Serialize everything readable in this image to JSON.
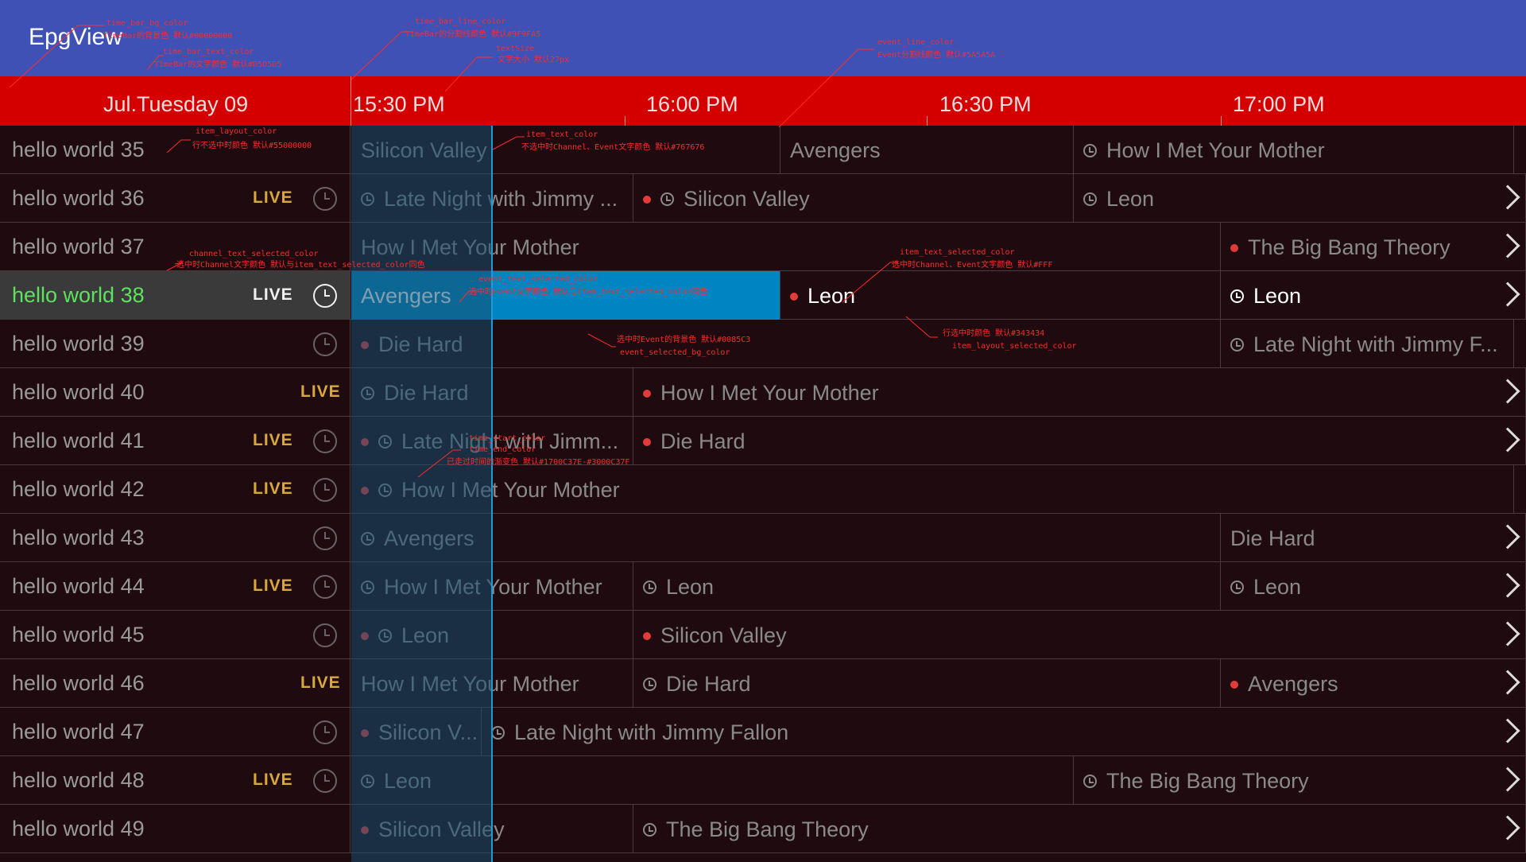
{
  "app": {
    "title": "EpgView"
  },
  "timebar": {
    "date": "Jul.Tuesday 09",
    "ticks": [
      "15:30 PM",
      "16:00 PM",
      "16:30 PM",
      "17:00 PM"
    ]
  },
  "colors": {
    "appbar": "#3f51b5",
    "timebar_bg": "#d40000",
    "grid_bg": "#1e0a0f",
    "selected_event_bg": "#0085c3",
    "selected_row_bg": "#3a3a3a",
    "selected_channel_text": "#5de25d",
    "live_badge": "#d8a93a",
    "now_line": "#1d9bd8",
    "annotation": "#ff2a2a"
  },
  "rows": [
    {
      "channel": "hello world 35",
      "live": false,
      "clock": false,
      "chevron": false,
      "events": [
        {
          "title": "Silicon Valley",
          "dot": false,
          "alarm": false
        },
        {
          "title": "Avengers",
          "dot": false,
          "alarm": false
        },
        {
          "title": "How I Met Your Mother",
          "dot": false,
          "alarm": true
        }
      ]
    },
    {
      "channel": "hello world 36",
      "live": true,
      "clock": true,
      "chevron": true,
      "events": [
        {
          "title": "Late Night with Jimmy ...",
          "dot": false,
          "alarm": true
        },
        {
          "title": "Silicon Valley",
          "dot": true,
          "alarm": true
        },
        {
          "title": "Leon",
          "dot": false,
          "alarm": true
        }
      ]
    },
    {
      "channel": "hello world 37",
      "live": false,
      "clock": false,
      "chevron": true,
      "events": [
        {
          "title": "How I Met Your Mother",
          "dot": false,
          "alarm": false
        },
        {
          "title": "The Big Bang Theory",
          "dot": true,
          "alarm": false
        }
      ]
    },
    {
      "channel": "hello world 38",
      "live": true,
      "clock": true,
      "chevron": true,
      "selected": true,
      "events": [
        {
          "title": "Avengers",
          "dot": false,
          "alarm": false,
          "selected": true
        },
        {
          "title": "Leon",
          "dot": true,
          "alarm": false
        },
        {
          "title": "Leon",
          "dot": false,
          "alarm": true
        }
      ]
    },
    {
      "channel": "hello world 39",
      "live": false,
      "clock": true,
      "chevron": false,
      "events": [
        {
          "title": "Die Hard",
          "dot": true,
          "alarm": false
        },
        {
          "title": "Late Night with Jimmy F...",
          "dot": false,
          "alarm": true
        }
      ]
    },
    {
      "channel": "hello world 40",
      "live": true,
      "clock": false,
      "chevron": true,
      "events": [
        {
          "title": "Die Hard",
          "dot": false,
          "alarm": true
        },
        {
          "title": "How I Met Your Mother",
          "dot": true,
          "alarm": false
        }
      ]
    },
    {
      "channel": "hello world 41",
      "live": true,
      "clock": true,
      "chevron": true,
      "events": [
        {
          "title": "Late Night with Jimm...",
          "dot": true,
          "alarm": true
        },
        {
          "title": "Die Hard",
          "dot": true,
          "alarm": false
        }
      ]
    },
    {
      "channel": "hello world 42",
      "live": true,
      "clock": true,
      "chevron": false,
      "events": [
        {
          "title": "How I Met Your Mother",
          "dot": true,
          "alarm": true
        }
      ]
    },
    {
      "channel": "hello world 43",
      "live": false,
      "clock": true,
      "chevron": true,
      "events": [
        {
          "title": "Avengers",
          "dot": false,
          "alarm": true
        },
        {
          "title": "Die Hard",
          "dot": false,
          "alarm": false
        }
      ]
    },
    {
      "channel": "hello world 44",
      "live": true,
      "clock": true,
      "chevron": true,
      "events": [
        {
          "title": "How I Met Your Mother",
          "dot": false,
          "alarm": true
        },
        {
          "title": "Leon",
          "dot": false,
          "alarm": true
        },
        {
          "title": "Leon",
          "dot": false,
          "alarm": true
        }
      ]
    },
    {
      "channel": "hello world 45",
      "live": false,
      "clock": true,
      "chevron": true,
      "events": [
        {
          "title": "Leon",
          "dot": true,
          "alarm": true
        },
        {
          "title": "Silicon Valley",
          "dot": true,
          "alarm": false
        }
      ]
    },
    {
      "channel": "hello world 46",
      "live": true,
      "clock": false,
      "chevron": true,
      "events": [
        {
          "title": "How I Met Your Mother",
          "dot": false,
          "alarm": false
        },
        {
          "title": "Die Hard",
          "dot": false,
          "alarm": true
        },
        {
          "title": "Avengers",
          "dot": true,
          "alarm": false
        }
      ]
    },
    {
      "channel": "hello world 47",
      "live": false,
      "clock": true,
      "chevron": true,
      "events": [
        {
          "title": "Silicon V...",
          "dot": true,
          "alarm": false
        },
        {
          "title": "Late Night with Jimmy Fallon",
          "dot": false,
          "alarm": true
        }
      ]
    },
    {
      "channel": "hello world 48",
      "live": true,
      "clock": true,
      "chevron": true,
      "events": [
        {
          "title": "Leon",
          "dot": false,
          "alarm": true
        },
        {
          "title": "The Big Bang Theory",
          "dot": false,
          "alarm": true
        }
      ]
    },
    {
      "channel": "hello world 49",
      "live": false,
      "clock": false,
      "chevron": true,
      "events": [
        {
          "title": "Silicon Valley",
          "dot": true,
          "alarm": false
        },
        {
          "title": "The Big Bang Theory",
          "dot": false,
          "alarm": true
        }
      ]
    }
  ],
  "live_label": "LIVE",
  "annotations": [
    "time_bar_bg_color",
    "TimeBar的背景色 默认#00000000",
    "time_bar_text_color",
    "TimeBar的文字颜色 默认#D5D5D5",
    "time_bar_line_color",
    "TimeBar的分割线颜色 默认#9F9FA5",
    "textSize",
    "文字大小 默认27px",
    "event_line_color",
    "Event分割线颜色 默认#5A5A5A",
    "item_layout_color",
    "行不选中时颜色 默认#55000000",
    "item_text_color",
    "不选中时Channel、Event文字颜色 默认#767676",
    "channel_text_selected_color",
    "选中时Channel文字颜色 默认与item_text_selected_color同色",
    "event_text_selected_color",
    "选中时Event文字颜色 默认与item_text_selected_color同色",
    "item_text_selected_color",
    "选中时Channel、Event文字颜色 默认#FFF",
    "选中时Event的背景色 默认#0085C3",
    "event_selected_bg_color",
    "行选中时颜色 默认#343434",
    "item_layout_selected_color",
    "time_start_color",
    "time_end_color",
    "已走过时间的渐变色 默认#1700C37E-#3000C37F"
  ]
}
